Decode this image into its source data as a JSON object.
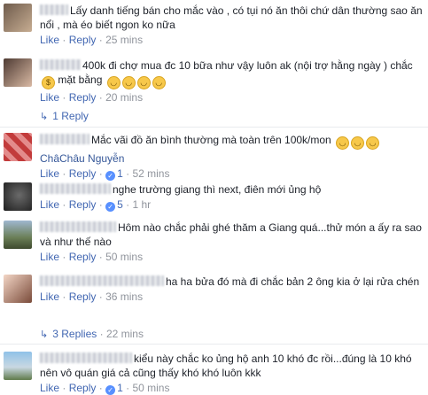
{
  "comments": [
    {
      "text": "Lấy danh tiếng bán cho mắc vào , có tụi nó ăn thôi chứ dân thường sao ăn nổi , mà éo biết ngon ko nữa",
      "like": "Like",
      "reply": "Reply",
      "time": "25 mins"
    },
    {
      "text": "400k đi chợ mua đc 10 bữa như vậy luôn ak (nội trợ hằng ngày ) chắc",
      "text2": "mặt bằng",
      "like": "Like",
      "reply": "Reply",
      "time": "20 mins",
      "replies": "1 Reply"
    },
    {
      "text": "Mắc vãi đồ ăn bình thường mà toàn trên 100k/mon",
      "mention": "ChâChâu Nguyễn",
      "like": "Like",
      "reply": "Reply",
      "likes": "1",
      "time": "52 mins"
    },
    {
      "text": "nghe trường giang thì next, điên mới ủng hộ",
      "like": "Like",
      "reply": "Reply",
      "likes": "5",
      "time": "1 hr"
    },
    {
      "text": "Hôm nào chắc phải ghé thăm a Giang quá...thử món a ấy ra sao và như thế nào",
      "like": "Like",
      "reply": "Reply",
      "time": "50 mins"
    },
    {
      "text": "ha ha bửa đó mà đi chắc bản 2 ông kia ở lại rửa chén",
      "like": "Like",
      "reply": "Reply",
      "time": "36 mins",
      "replies": "3 Replies",
      "replies_time": "22 mins"
    },
    {
      "text": "kiểu này chắc ko ủng hộ anh 10 khó đc rồi...đúng là 10 khó nên vô quán giá cả cũng thấy khó khó luôn kkk",
      "like": "Like",
      "reply": "Reply",
      "likes": "1",
      "time": "50 mins"
    }
  ],
  "separator": "·",
  "colors": {
    "link": "#4267b2",
    "meta": "#90949c",
    "text": "#1d2129"
  }
}
